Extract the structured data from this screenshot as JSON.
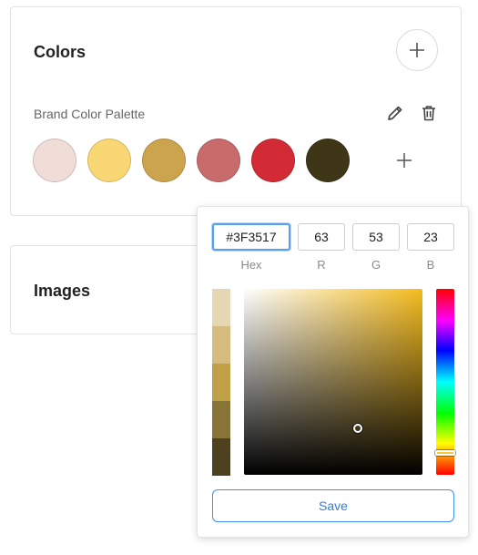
{
  "colors_section": {
    "title": "Colors",
    "palette": {
      "name": "Brand Color Palette",
      "swatches": [
        "#F0DDD7",
        "#F8D774",
        "#CDA44E",
        "#C86B6B",
        "#D22B36",
        "#3F3517"
      ]
    }
  },
  "images_section": {
    "title": "Images"
  },
  "picker": {
    "hex": {
      "value": "#3F3517",
      "label": "Hex"
    },
    "r": {
      "value": "63",
      "label": "R"
    },
    "g": {
      "value": "53",
      "label": "G"
    },
    "b": {
      "value": "23",
      "label": "B"
    },
    "shades": [
      "#E5D7B3",
      "#D5BC7E",
      "#BFA046",
      "#877436",
      "#4D411F"
    ],
    "hue_color": "#F5BC20",
    "hue_level": 0.88,
    "saturation": 0.64,
    "value": 0.25,
    "save_label": "Save"
  },
  "colors": {
    "accent": "#2F7DE1"
  },
  "icons": {
    "add": "plus-icon",
    "edit": "pencil-icon",
    "delete": "trash-icon"
  }
}
